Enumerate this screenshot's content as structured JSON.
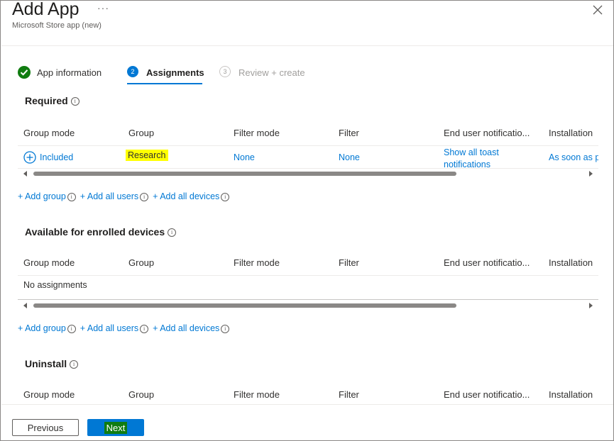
{
  "header": {
    "title": "Add App",
    "more_label": "···",
    "subtitle": "Microsoft Store app (new)",
    "close_icon": "close-icon"
  },
  "wizard": {
    "steps": [
      {
        "number": "",
        "label": "App information",
        "state": "completed"
      },
      {
        "number": "2",
        "label": "Assignments",
        "state": "active"
      },
      {
        "number": "3",
        "label": "Review + create",
        "state": "disabled"
      }
    ]
  },
  "columns": [
    "Group mode",
    "Group",
    "Filter mode",
    "Filter",
    "End user notificatio...",
    "Installation"
  ],
  "sections": {
    "required": {
      "title": "Required",
      "rows": [
        {
          "group_mode": "Included",
          "group": "Research",
          "filter_mode": "None",
          "filter": "None",
          "notifications_line1": "Show all toast",
          "notifications_line2": "notifications",
          "installation": "As soon as p"
        }
      ]
    },
    "available": {
      "title": "Available for enrolled devices",
      "empty_text": "No assignments"
    },
    "uninstall": {
      "title": "Uninstall"
    }
  },
  "add_links": {
    "add_group": "+ Add group",
    "add_all_users": "+ Add all users",
    "add_all_devices": "+ Add all devices"
  },
  "footer": {
    "previous_label": "Previous",
    "next_label": "Next"
  },
  "colors": {
    "accent": "#0078d4",
    "success": "#107c10",
    "highlight": "#ffff00"
  }
}
